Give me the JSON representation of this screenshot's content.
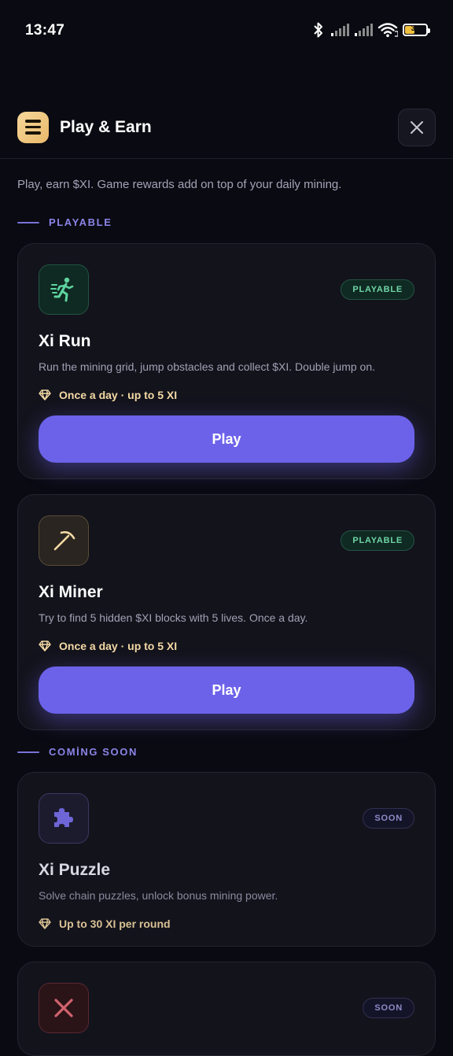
{
  "status_bar": {
    "time": "13:47",
    "battery_level": "39",
    "icons": [
      "bluetooth-icon",
      "signal-icon",
      "signal-icon",
      "wifi-icon",
      "battery-icon"
    ]
  },
  "header": {
    "logo_icon": "menu-lines-icon",
    "title": "Play & Earn",
    "close_icon": "close-icon"
  },
  "intro": "Play, earn $XI. Game rewards add on top of your daily mining.",
  "sections": {
    "playable_label": "PLAYABLE",
    "coming_soon_label": "COMİNG SOON"
  },
  "games": [
    {
      "icon": "running-person-icon",
      "badge": "PLAYABLE",
      "title": "Xi Run",
      "description": "Run the mining grid, jump obstacles and collect $XI. Double jump on.",
      "reward": "Once a day · up to 5 XI",
      "button": "Play"
    },
    {
      "icon": "pickaxe-icon",
      "badge": "PLAYABLE",
      "title": "Xi Miner",
      "description": "Try to find 5 hidden $XI blocks with 5 lives. Once a day.",
      "reward": "Once a day · up to 5 XI",
      "button": "Play"
    },
    {
      "icon": "puzzle-icon",
      "badge": "SOON",
      "title": "Xi Puzzle",
      "description": "Solve chain puzzles, unlock bonus mining power.",
      "reward": "Up to 30 XI per round"
    },
    {
      "icon": "crossed-swords-icon",
      "badge": "SOON"
    }
  ],
  "colors": {
    "background": "#0a0a12",
    "accent": "#6c62ea",
    "playable_green": "#6fd4a6",
    "reward_gold": "#f3d9a4"
  }
}
